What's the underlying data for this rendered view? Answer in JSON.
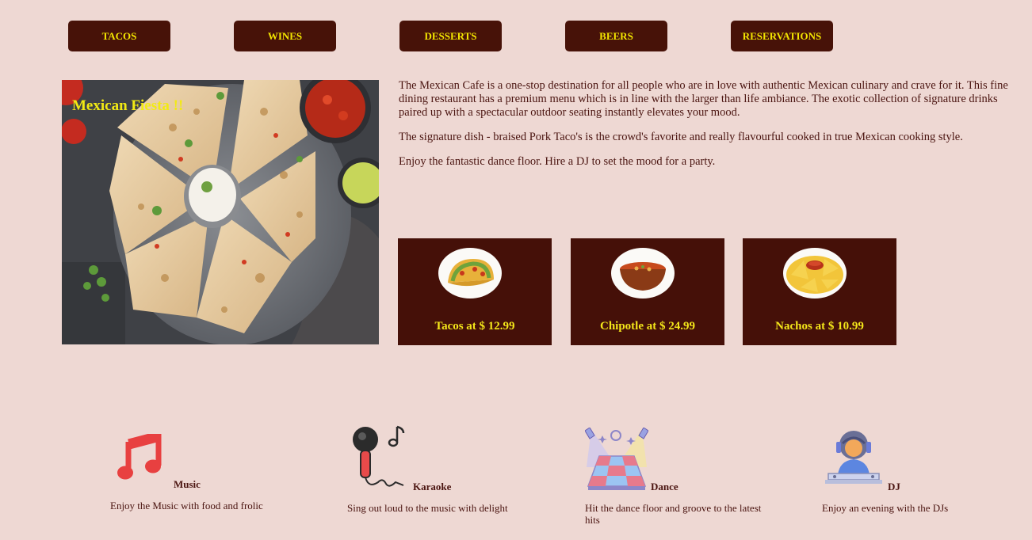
{
  "nav": {
    "items": [
      {
        "label": "TACOS"
      },
      {
        "label": "WINES"
      },
      {
        "label": "DESSERTS"
      },
      {
        "label": "BEERS"
      },
      {
        "label": "RESERVATIONS"
      }
    ]
  },
  "hero": {
    "title": "Mexican Fiesta !!"
  },
  "about": {
    "paragraphs": [
      "The Mexican Cafe is a one-stop destination for all people who are in love with authentic Mexican culinary and crave for it. This fine dining restaurant has a premium menu which is in line with the larger than life ambiance. The exotic collection of signature drinks paired up with a spectacular outdoor seating instantly elevates your mood.",
      "The signature dish - braised Pork Taco's is the crowd's favorite and really flavourful cooked in true Mexican cooking style.",
      "Enjoy the fantastic dance floor. Hire a DJ to set the mood for a party."
    ]
  },
  "menu_cards": [
    {
      "label": "Tacos at $ 12.99",
      "icon": "taco-icon"
    },
    {
      "label": "Chipotle at $ 24.99",
      "icon": "chipotle-bowl-icon"
    },
    {
      "label": "Nachos at $ 10.99",
      "icon": "nachos-icon"
    }
  ],
  "features": [
    {
      "title": "Music",
      "desc": "Enjoy the Music with food and frolic",
      "icon": "music-note-icon"
    },
    {
      "title": "Karaoke",
      "desc": "Sing out loud to the music with delight",
      "icon": "microphone-icon"
    },
    {
      "title": "Dance",
      "desc": "Hit the dance floor and groove to the latest hits",
      "icon": "dance-floor-icon"
    },
    {
      "title": "DJ",
      "desc": "Enjoy an evening with the DJs",
      "icon": "dj-icon"
    }
  ],
  "colors": {
    "background": "#eed8d3",
    "button": "#471208",
    "accent_text": "#f3e600",
    "body_text": "#4a1410"
  }
}
